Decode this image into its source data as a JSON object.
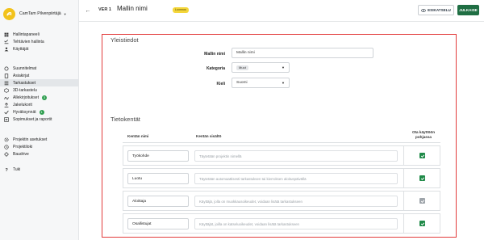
{
  "sidebar": {
    "brand": "CamTam Pilvenpiirtäjä",
    "items": [
      {
        "label": "Hallintapaneeli",
        "icon": "dashboard-icon",
        "badge": null
      },
      {
        "label": "Tehtävien hallinta",
        "icon": "checklist-icon",
        "badge": null
      },
      {
        "label": "Käyttäjät",
        "icon": "users-icon",
        "badge": null
      },
      {
        "label": "Suunnitelmat",
        "icon": "refresh-icon",
        "badge": null
      },
      {
        "label": "Asiakirjat",
        "icon": "document-icon",
        "badge": null
      },
      {
        "label": "Tarkastukset",
        "icon": "list-icon",
        "badge": null
      },
      {
        "label": "3D-tarkastelu",
        "icon": "cube-icon",
        "badge": null
      },
      {
        "label": "Allekirjoitukset",
        "icon": "signature-icon",
        "badge": "3"
      },
      {
        "label": "Jakelukorit",
        "icon": "share-icon",
        "badge": null
      },
      {
        "label": "Hyväksynnät",
        "icon": "approval-icon",
        "badge": "1"
      },
      {
        "label": "Sopimukset ja raportit",
        "icon": "report-icon",
        "badge": null
      },
      {
        "label": "Projektin asetukset",
        "icon": "gear-icon",
        "badge": null
      },
      {
        "label": "Projektiloki",
        "icon": "clock-icon",
        "badge": null
      },
      {
        "label": "Baudrive",
        "icon": "drive-icon",
        "badge": null
      },
      {
        "label": "Tuki",
        "icon": "help-icon",
        "badge": null
      }
    ],
    "active_index": 5
  },
  "topbar": {
    "version": "VER 1",
    "title": "Mallin nimi",
    "status": "Luonnos",
    "preview_label": "ESIKATSELU",
    "publish_label": "JULKAISE"
  },
  "general": {
    "title": "Yleistiedot",
    "name_label": "Mallin nimi",
    "name_value": "Mallin nimi",
    "category_label": "Kategoria",
    "category_value": "Muut",
    "language_label": "Kieli",
    "language_value": "Suomi"
  },
  "fields": {
    "title": "Tietokentät",
    "col_name": "Kentän nimi",
    "col_content": "Kentän sisältö",
    "col_enabled": "Ota käyttöön pohjassa",
    "rows": [
      {
        "name": "Työkohde",
        "placeholder": "Täytetään projektin nimellä",
        "checked": true,
        "disabled": false
      },
      {
        "name": "Luotu",
        "placeholder": "Täytetään automaattisesti tarkastuksen tai kierroksen aloituspäivällä",
        "checked": true,
        "disabled": false
      },
      {
        "name": "Aloittaja",
        "placeholder": "Käyttäjä, jolla on muokkausoikeudet, voidaan lisätä tarkastukseen",
        "checked": true,
        "disabled": true
      },
      {
        "name": "Osallistujat",
        "placeholder": "Käyttäjät, joilla on katseluoikeudet, voidaan lisätä tarkastukseen",
        "checked": true,
        "disabled": false
      }
    ]
  },
  "colors": {
    "accent_green": "#1f6e43",
    "checkbox_green": "#1f8a48",
    "highlight_red": "#e23b3b",
    "status_yellow": "#f4d63a",
    "logo_yellow": "#f2c21b"
  }
}
